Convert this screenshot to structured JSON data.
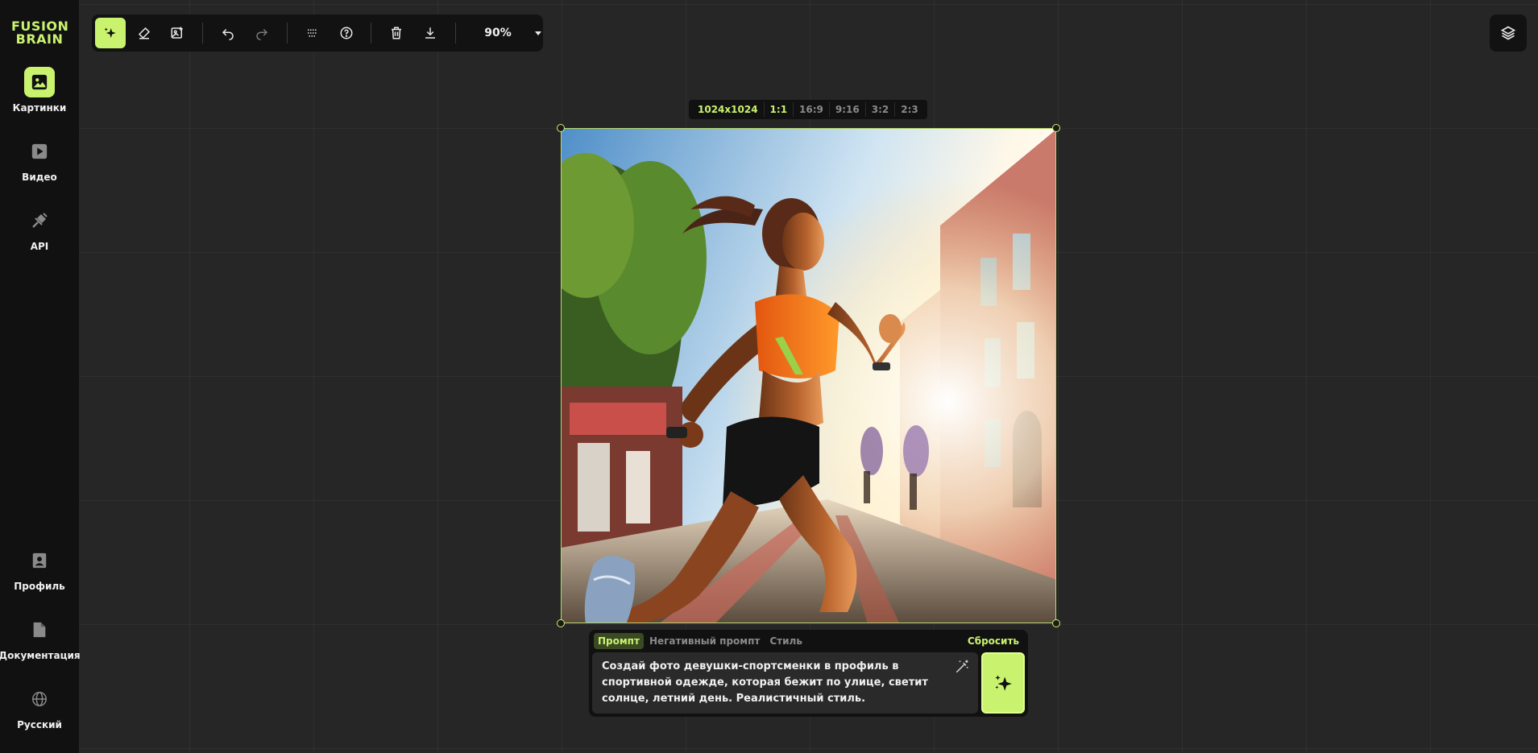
{
  "brand": {
    "line1": "FUSION",
    "line2": "BRAIN",
    "color": "#c9f36f"
  },
  "sidebar": {
    "items": [
      {
        "label": "Картинки",
        "icon": "image-icon",
        "active": true
      },
      {
        "label": "Видео",
        "icon": "video-icon",
        "active": false
      },
      {
        "label": "API",
        "icon": "plug-icon",
        "active": false
      }
    ],
    "bottom_items": [
      {
        "label": "Профиль",
        "icon": "profile-icon"
      },
      {
        "label": "Документация",
        "icon": "document-icon"
      },
      {
        "label": "Русский",
        "icon": "globe-icon"
      }
    ]
  },
  "toolbar": {
    "tools": [
      "generate-icon",
      "eraser-icon",
      "image-edit-icon",
      "undo-icon",
      "redo-icon",
      "grid-dots-icon",
      "help-icon",
      "trash-icon",
      "download-icon"
    ],
    "zoom": "90%"
  },
  "ratio_bar": {
    "size": "1024x1024",
    "ratios": [
      "1:1",
      "16:9",
      "9:16",
      "3:2",
      "2:3"
    ],
    "active": "1:1"
  },
  "prompt": {
    "tabs": [
      "Промпт",
      "Негативный промпт",
      "Стиль"
    ],
    "active_tab": "Промпт",
    "reset_label": "Сбросить",
    "text": "Создай фото девушки-спортсменки в профиль в\nспортивной одежде, которая бежит по улице, светит\nсолнце, летний день. Реалистичный стиль."
  },
  "colors": {
    "accent": "#c9f36f",
    "panel": "#111111",
    "canvas": "#262626"
  }
}
